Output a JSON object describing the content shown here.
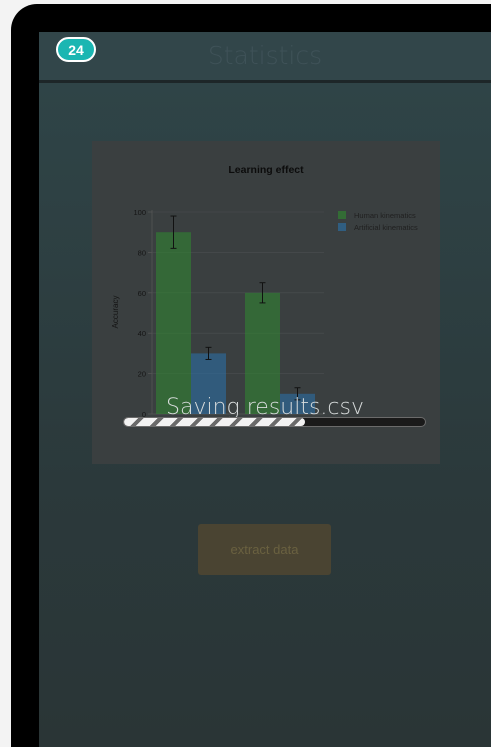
{
  "app": {
    "title": "Statistics",
    "badge": "24"
  },
  "chart_data": {
    "type": "bar",
    "title": "Learning effect",
    "xlabel": "",
    "ylabel": "Accuracy",
    "ylim": [
      0,
      100
    ],
    "yticks": [
      "0",
      "20",
      "40",
      "60",
      "80",
      "100"
    ],
    "categories": [
      "short term memory",
      "long term memory"
    ],
    "series": [
      {
        "name": "Human kinematics",
        "color": "#2f8b2f",
        "values": [
          90,
          60
        ],
        "errors": [
          8,
          5
        ]
      },
      {
        "name": "Artificial kinematics",
        "color": "#2a73ad",
        "values": [
          30,
          10
        ],
        "errors": [
          3,
          3
        ]
      }
    ],
    "legend": "top-right",
    "grid": true
  },
  "overlay": {
    "message": "Saving results.csv",
    "progress": 0.6
  },
  "actions": {
    "extract_label": "extract data"
  },
  "colors": {
    "badge": "#1bb6b2",
    "screen_bg": "#2b3a3d"
  }
}
